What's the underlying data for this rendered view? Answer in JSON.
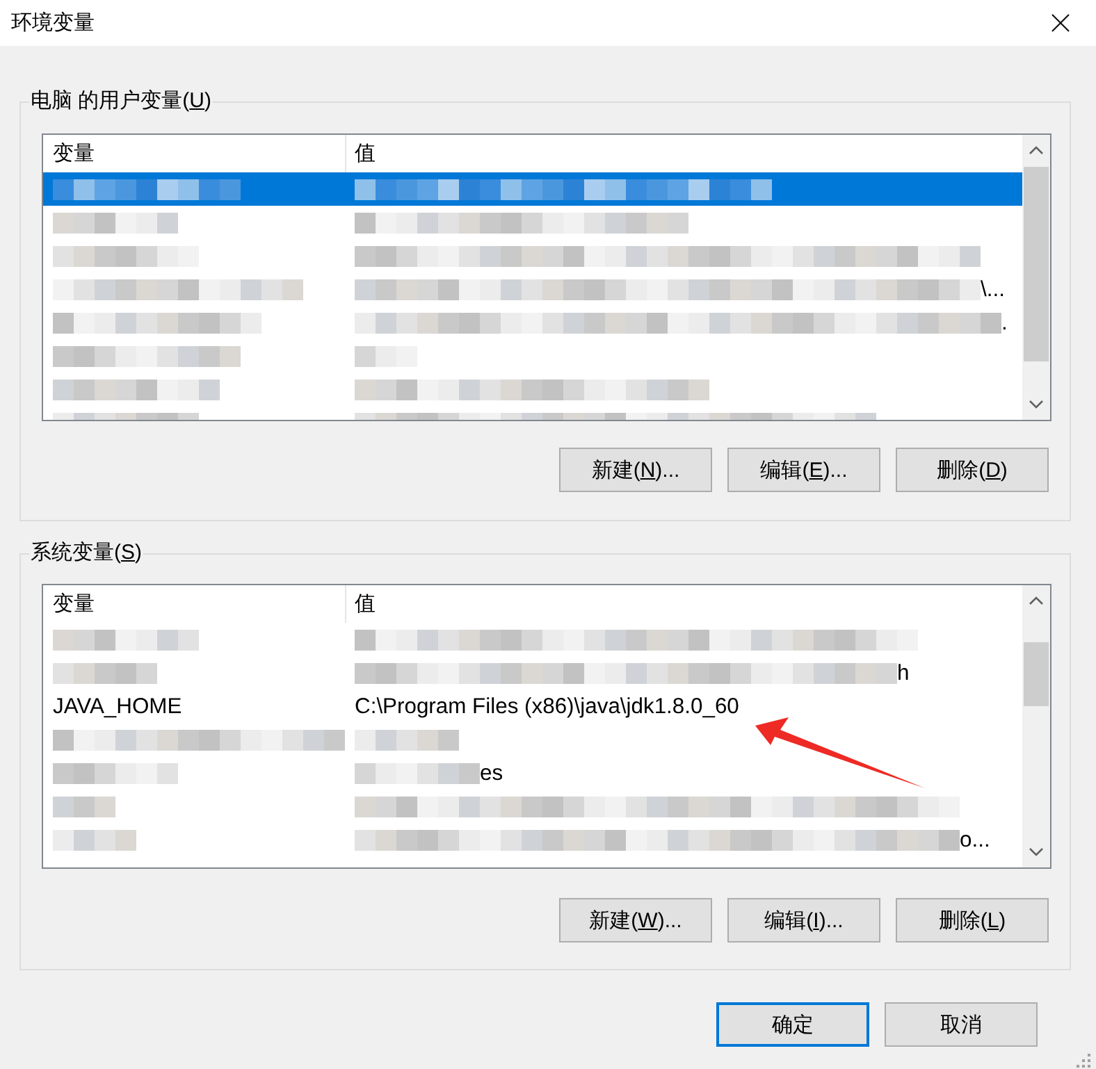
{
  "window": {
    "title": "环境变量"
  },
  "user_variables": {
    "label": {
      "pre": "电脑 的用户变量(",
      "access_key": "U",
      "post": ")"
    },
    "columns": [
      "变量",
      "值"
    ],
    "rows": [
      {
        "selected": true,
        "name": {
          "kind": "blurred"
        },
        "value": {
          "kind": "blurred"
        }
      },
      {
        "selected": false,
        "name": {
          "kind": "blurred"
        },
        "value": {
          "kind": "blurred"
        }
      },
      {
        "selected": false,
        "name": {
          "kind": "blurred"
        },
        "value": {
          "kind": "blurred"
        }
      },
      {
        "selected": false,
        "name": {
          "kind": "blurred"
        },
        "value": {
          "kind": "blurred",
          "tail": "\\..."
        }
      },
      {
        "selected": false,
        "name": {
          "kind": "blurred"
        },
        "value": {
          "kind": "blurred",
          "tail": "."
        }
      },
      {
        "selected": false,
        "name": {
          "kind": "blurred"
        },
        "value": {
          "kind": "blurred"
        }
      },
      {
        "selected": false,
        "name": {
          "kind": "blurred"
        },
        "value": {
          "kind": "blurred"
        }
      },
      {
        "selected": false,
        "name": {
          "kind": "blurred"
        },
        "value": {
          "kind": "blurred"
        }
      }
    ],
    "buttons": [
      {
        "pre": "新建(",
        "access_key": "N",
        "post": ")..."
      },
      {
        "pre": "编辑(",
        "access_key": "E",
        "post": ")..."
      },
      {
        "pre": "删除(",
        "access_key": "D",
        "post": ")"
      }
    ]
  },
  "system_variables": {
    "label": {
      "pre": "系统变量(",
      "access_key": "S",
      "post": ")"
    },
    "columns": [
      "变量",
      "值"
    ],
    "rows": [
      {
        "selected": false,
        "marked": false,
        "name": {
          "kind": "blurred"
        },
        "value": {
          "kind": "blurred"
        }
      },
      {
        "selected": false,
        "marked": false,
        "name": {
          "kind": "blurred"
        },
        "value": {
          "kind": "blurred",
          "tail": "h"
        }
      },
      {
        "selected": false,
        "marked": true,
        "name": {
          "kind": "text",
          "text": "JAVA_HOME"
        },
        "value": {
          "kind": "text",
          "text": "C:\\Program Files (x86)\\java\\jdk1.8.0_60"
        }
      },
      {
        "selected": false,
        "marked": false,
        "name": {
          "kind": "blurred"
        },
        "value": {
          "kind": "blurred"
        }
      },
      {
        "selected": false,
        "marked": false,
        "name": {
          "kind": "blurred"
        },
        "value": {
          "kind": "blurred",
          "tail": "es"
        }
      },
      {
        "selected": false,
        "marked": false,
        "name": {
          "kind": "blurred"
        },
        "value": {
          "kind": "blurred"
        }
      },
      {
        "selected": false,
        "marked": false,
        "name": {
          "kind": "blurred"
        },
        "value": {
          "kind": "blurred",
          "tail": "o..."
        }
      }
    ],
    "buttons": [
      {
        "pre": "新建(",
        "access_key": "W",
        "post": ")..."
      },
      {
        "pre": "编辑(",
        "access_key": "I",
        "post": ")..."
      },
      {
        "pre": "删除(",
        "access_key": "L",
        "post": ")"
      }
    ]
  },
  "dialog_buttons": [
    {
      "label": "确定",
      "default": true
    },
    {
      "label": "取消",
      "default": false
    }
  ]
}
